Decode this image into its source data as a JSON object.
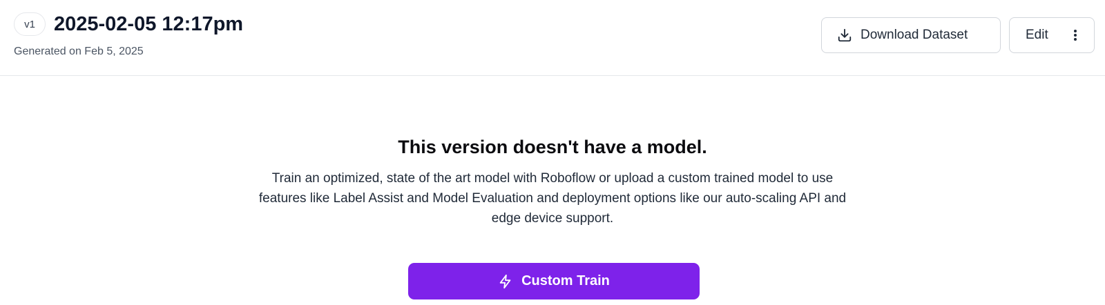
{
  "header": {
    "version_badge": "v1",
    "title": "2025-02-05 12:17pm",
    "generated": "Generated on Feb 5, 2025",
    "download_label": "Download Dataset",
    "download_icon": "download-icon",
    "edit_label": "Edit",
    "more_icon": "more-vertical-icon"
  },
  "empty_state": {
    "title": "This version doesn't have a model.",
    "description": "Train an optimized, state of the art model with Roboflow or upload a custom trained model to use features like Label Assist and Model Evaluation and deployment options like our auto-scaling API and edge device support.",
    "cta_label": "Custom Train",
    "cta_icon": "lightning-icon"
  },
  "colors": {
    "accent": "#7e22ea",
    "border": "#e5e7eb",
    "text_primary": "#0f172a",
    "text_secondary": "#4b5563"
  }
}
